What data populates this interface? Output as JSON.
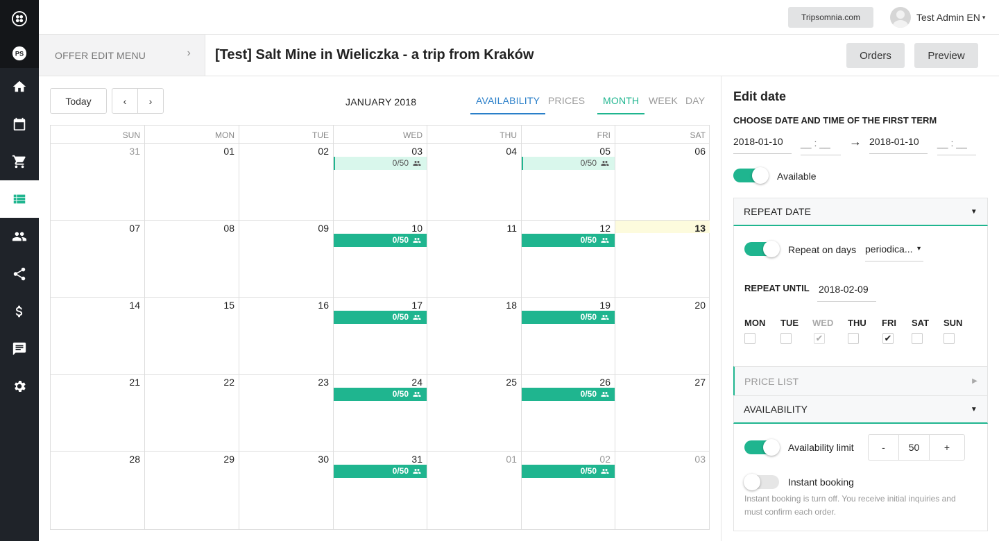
{
  "topbar": {
    "site_button": "Tripsomnia.com",
    "user_name": "Test Admin EN",
    "user_caret": "▾"
  },
  "offer_menu": {
    "label": "OFFER EDIT MENU",
    "chevron": "›"
  },
  "page_title": "[Test] Salt Mine in Wieliczka - a trip from Kraków",
  "actions": {
    "orders": "Orders",
    "preview": "Preview"
  },
  "sidebar": {
    "icons": [
      "logo-icon",
      "ps-icon",
      "home-icon",
      "calendar-icon",
      "cart-icon",
      "list-icon",
      "people-icon",
      "share-icon",
      "dollar-icon",
      "chat-icon",
      "gear-icon"
    ],
    "active": "list-icon",
    "ps_text": "PS"
  },
  "calendar": {
    "today_button": "Today",
    "prev": "‹",
    "next": "›",
    "month_label": "JANUARY 2018",
    "tabs": [
      "AVAILABILITY",
      "PRICES"
    ],
    "views": [
      "MONTH",
      "WEEK",
      "DAY"
    ],
    "active_tab": "AVAILABILITY",
    "active_view": "MONTH",
    "weekdays": [
      "SUN",
      "MON",
      "TUE",
      "WED",
      "THU",
      "FRI",
      "SAT"
    ],
    "weeks": [
      [
        {
          "d": "31",
          "o": true
        },
        {
          "d": "01"
        },
        {
          "d": "02"
        },
        {
          "d": "03",
          "ev": "0/50",
          "style": "light"
        },
        {
          "d": "04"
        },
        {
          "d": "05",
          "ev": "0/50",
          "style": "light"
        },
        {
          "d": "06"
        }
      ],
      [
        {
          "d": "07"
        },
        {
          "d": "08"
        },
        {
          "d": "09"
        },
        {
          "d": "10",
          "ev": "0/50",
          "style": "solid"
        },
        {
          "d": "11"
        },
        {
          "d": "12",
          "ev": "0/50",
          "style": "solid"
        },
        {
          "d": "13",
          "today": true
        }
      ],
      [
        {
          "d": "14"
        },
        {
          "d": "15"
        },
        {
          "d": "16"
        },
        {
          "d": "17",
          "ev": "0/50",
          "style": "solid"
        },
        {
          "d": "18"
        },
        {
          "d": "19",
          "ev": "0/50",
          "style": "solid"
        },
        {
          "d": "20"
        }
      ],
      [
        {
          "d": "21"
        },
        {
          "d": "22"
        },
        {
          "d": "23"
        },
        {
          "d": "24",
          "ev": "0/50",
          "style": "solid"
        },
        {
          "d": "25"
        },
        {
          "d": "26",
          "ev": "0/50",
          "style": "solid"
        },
        {
          "d": "27"
        }
      ],
      [
        {
          "d": "28"
        },
        {
          "d": "29"
        },
        {
          "d": "30"
        },
        {
          "d": "31",
          "ev": "0/50",
          "style": "solid"
        },
        {
          "d": "01",
          "o": true
        },
        {
          "d": "02",
          "o": true,
          "ev": "0/50",
          "style": "solid"
        },
        {
          "d": "03",
          "o": true
        }
      ]
    ],
    "colors": {
      "accent": "#1fb58f",
      "light": "#d9f7ec",
      "today": "#fdfbdd",
      "blue": "#2a7fc9"
    }
  },
  "edit": {
    "title": "Edit date",
    "choose_label": "CHOOSE DATE AND TIME OF THE FIRST TERM",
    "date_from": "2018-01-10",
    "time_from": "__ : __",
    "arrow": "→",
    "date_to": "2018-01-10",
    "time_to": "__ : __",
    "available_label": "Available",
    "repeat_header": "REPEAT DATE",
    "repeat_days_label": "Repeat on days",
    "repeat_select": "periodica...",
    "repeat_until_label": "REPEAT UNTIL",
    "repeat_until": "2018-02-09",
    "days": [
      {
        "label": "MON",
        "checked": false,
        "disabled": false
      },
      {
        "label": "TUE",
        "checked": false,
        "disabled": false
      },
      {
        "label": "WED",
        "checked": true,
        "disabled": true
      },
      {
        "label": "THU",
        "checked": false,
        "disabled": false
      },
      {
        "label": "FRI",
        "checked": true,
        "disabled": false
      },
      {
        "label": "SAT",
        "checked": false,
        "disabled": false
      },
      {
        "label": "SUN",
        "checked": false,
        "disabled": false
      }
    ],
    "price_list_header": "PRICE LIST",
    "availability_header": "AVAILABILITY",
    "limit_label": "Availability limit",
    "limit_minus": "-",
    "limit_value": "50",
    "limit_plus": "+",
    "instant_label": "Instant booking",
    "instant_note": "Instant booking is turn off. You receive initial inquiries and must confirm each order."
  }
}
